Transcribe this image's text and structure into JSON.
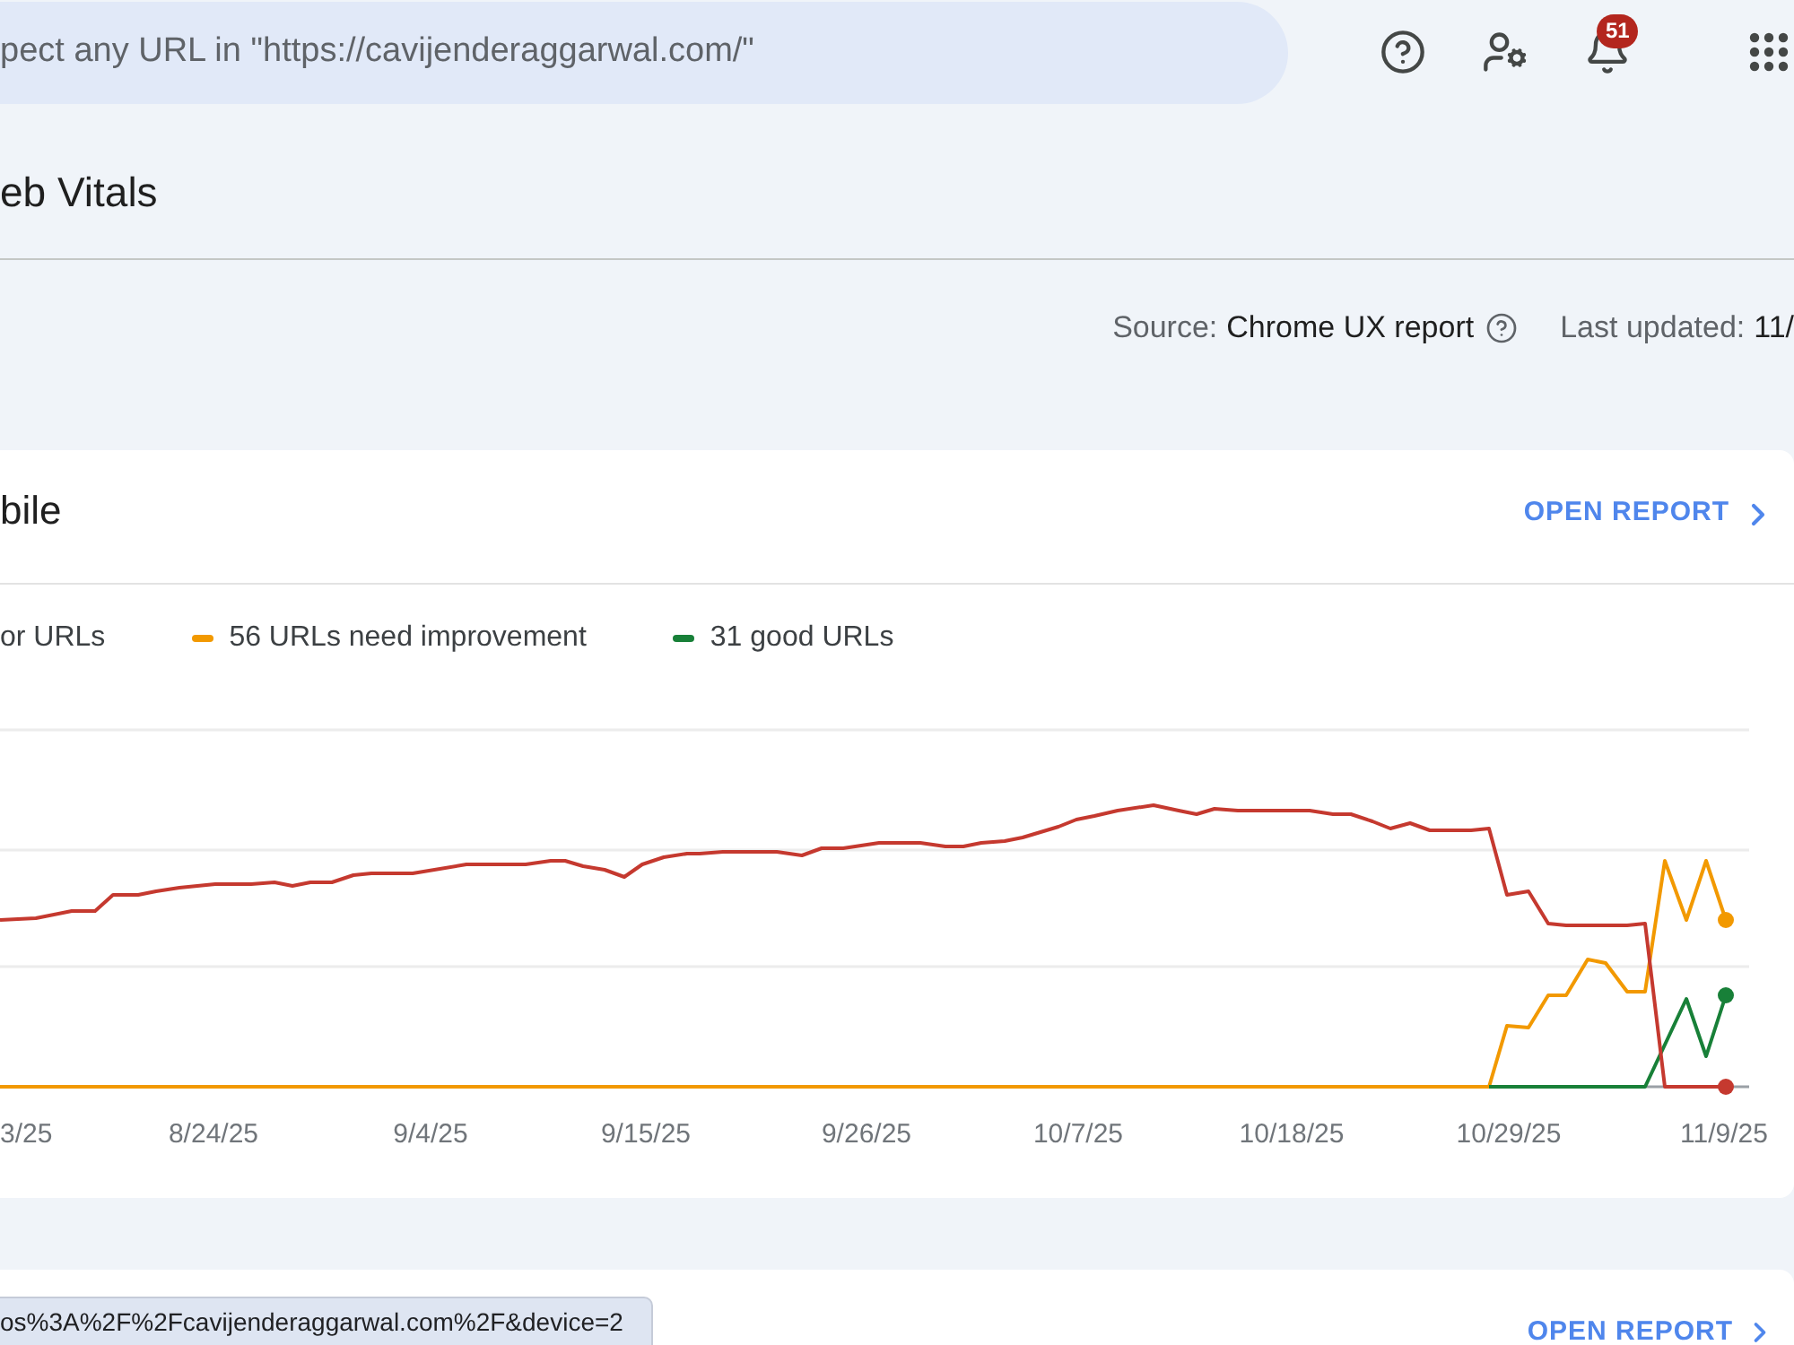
{
  "search": {
    "placeholder": "pect any URL in \"https://cavijenderaggarwal.com/\""
  },
  "toolbar": {
    "notification_count": "51"
  },
  "page": {
    "title": "eb Vitals"
  },
  "source": {
    "label": "Source:",
    "value": "Chrome UX report",
    "updated_label": "Last updated:",
    "updated_value": "11/"
  },
  "card": {
    "title": "bile",
    "action": "OPEN REPORT",
    "legend": [
      {
        "label": "or URLs"
      },
      {
        "label": "56 URLs need improvement",
        "color": "#f29900"
      },
      {
        "label": "31 good URLs",
        "color": "#188038"
      }
    ],
    "chart": {
      "lines": [
        {
          "color": "#c5392f"
        },
        {
          "color": "#f29900"
        },
        {
          "color": "#188038"
        }
      ],
      "x_labels": [
        "3/25",
        "8/24/25",
        "9/4/25",
        "9/15/25",
        "9/26/25",
        "10/7/25",
        "10/18/25",
        "10/29/25",
        "11/9/25"
      ]
    }
  },
  "next_card": {
    "action": "OPEN REPORT"
  },
  "status_url": "os%3A%2F%2Fcavijenderaggarwal.com%2F&device=2"
}
